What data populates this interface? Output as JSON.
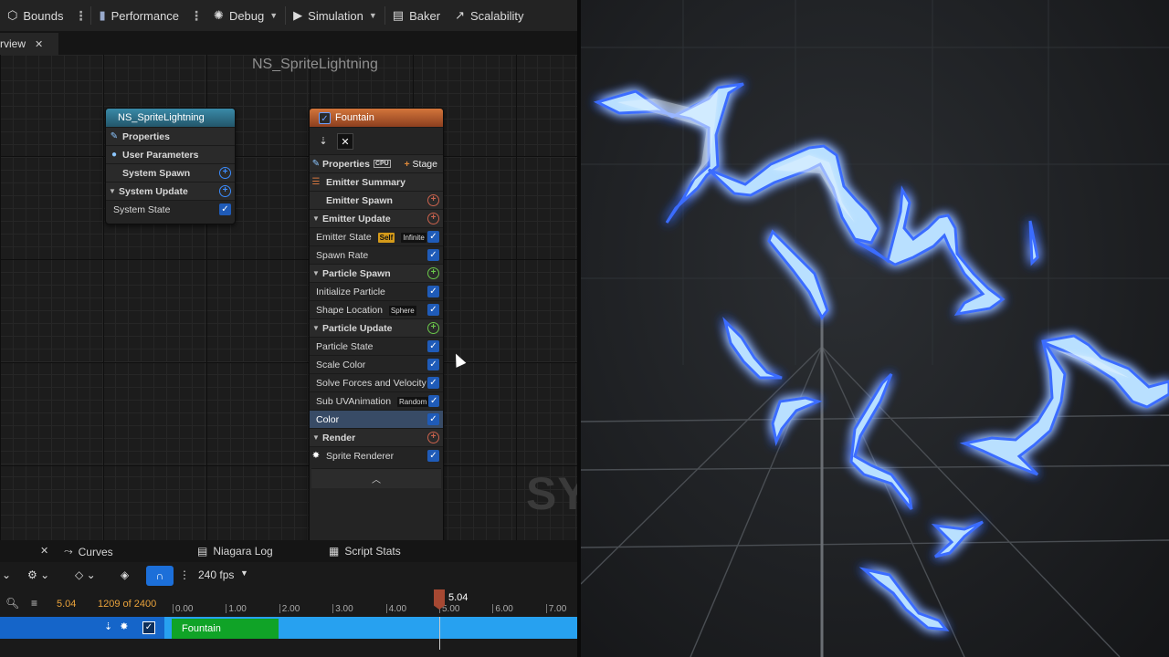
{
  "toolbar": {
    "bounds": "Bounds",
    "performance": "Performance",
    "debug": "Debug",
    "simulation": "Simulation",
    "baker": "Baker",
    "scalability": "Scalability"
  },
  "tabs": {
    "overview": "rview"
  },
  "graph": {
    "title": "NS_SpriteLightning",
    "watermark": "SY"
  },
  "system_node": {
    "title": "NS_SpriteLightning",
    "rows": {
      "properties": "Properties",
      "user_parameters": "User Parameters",
      "system_spawn": "System Spawn",
      "system_update": "System Update",
      "system_state": "System State"
    }
  },
  "emitter_node": {
    "title": "Fountain",
    "properties": "Properties",
    "cpu": "CPU",
    "stage": "Stage",
    "emitter_summary": "Emitter Summary",
    "emitter_spawn": "Emitter Spawn",
    "emitter_update": "Emitter Update",
    "emitter_state": "Emitter State",
    "tag_self": "Self",
    "tag_infinite": "Infinite",
    "spawn_rate": "Spawn Rate",
    "particle_spawn": "Particle Spawn",
    "initialize_particle": "Initialize Particle",
    "shape_location": "Shape Location",
    "tag_sphere": "Sphere",
    "particle_update": "Particle Update",
    "particle_state": "Particle State",
    "scale_color": "Scale Color",
    "solve_forces": "Solve Forces and Velocity",
    "sub_uv": "Sub UVAnimation",
    "tag_random": "Random",
    "color": "Color",
    "render": "Render",
    "sprite_renderer": "Sprite Renderer"
  },
  "bottom": {
    "tabs": {
      "curves": "Curves",
      "niagara_log": "Niagara Log",
      "script_stats": "Script Stats"
    },
    "fps": "240 fps",
    "current_time": "5.04",
    "frame": "1209 of 2400",
    "playhead": "5.04",
    "ruler": [
      "0.00",
      "1.00",
      "2.00",
      "3.00",
      "4.00",
      "5.00",
      "6.00",
      "7.00"
    ],
    "track_name": "Fountain"
  },
  "colors": {
    "system_header": "#3a8aa8",
    "emitter_header": "#d3753b",
    "accent_blue": "#1f5bb8",
    "track": "#27a1f0",
    "fountain_bar": "#10a327",
    "lightning": "#a9d8ff"
  }
}
